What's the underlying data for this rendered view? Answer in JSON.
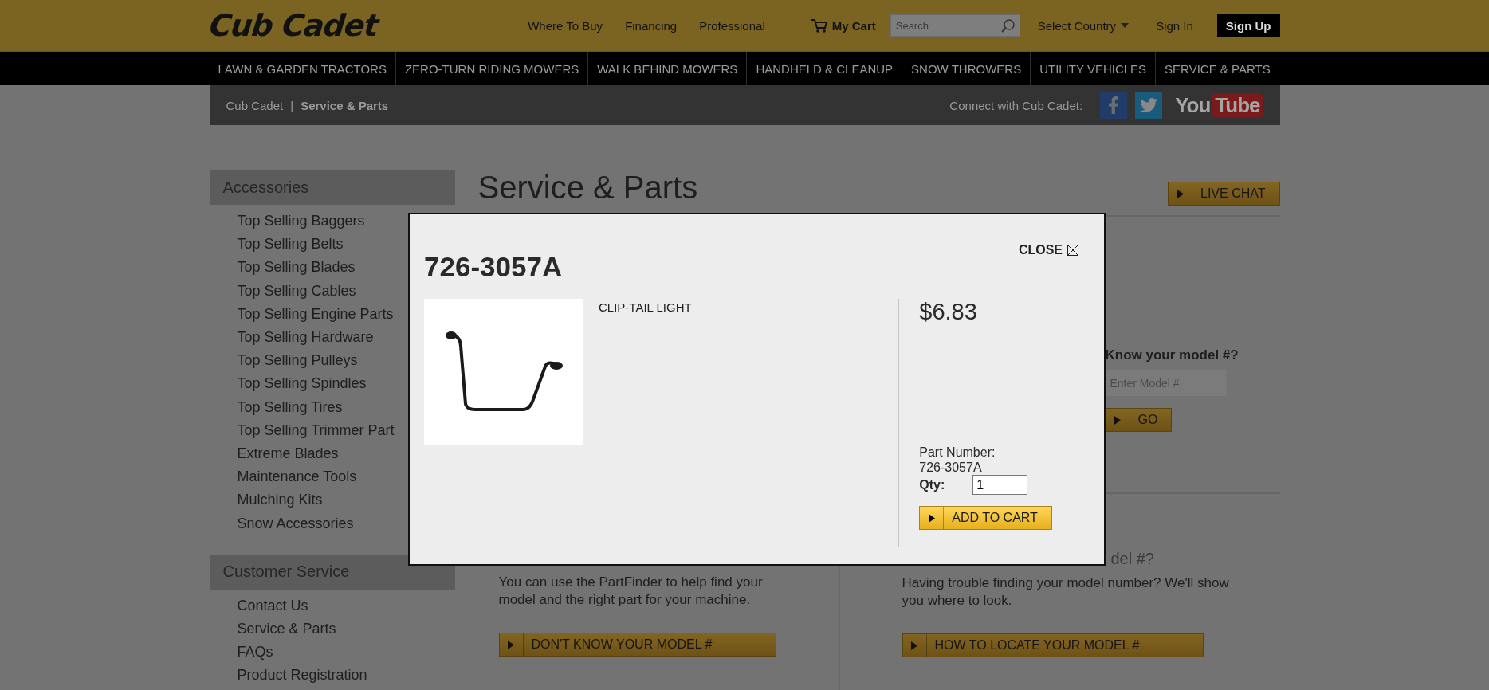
{
  "header": {
    "logo": "Cub Cadet",
    "links": [
      "Where To Buy",
      "Financing",
      "Professional"
    ],
    "cart": "My Cart",
    "search": {
      "placeholder": "Search"
    },
    "country": "Select Country",
    "sign_in": "Sign In",
    "sign_up": "Sign Up"
  },
  "nav": [
    "LAWN & GARDEN TRACTORS",
    "ZERO-TURN RIDING MOWERS",
    "WALK BEHIND MOWERS",
    "HANDHELD & CLEANUP",
    "SNOW THROWERS",
    "UTILITY VEHICLES",
    "SERVICE & PARTS"
  ],
  "breadcrumb": {
    "items": [
      {
        "label": "Cub Cadet",
        "current": false
      },
      {
        "label": "Service & Parts",
        "current": true
      }
    ],
    "separator": "|"
  },
  "social": {
    "label": "Connect with Cub Cadet:",
    "items": [
      {
        "kind": "facebook"
      },
      {
        "kind": "twitter"
      },
      {
        "kind": "youtube",
        "text": "You",
        "badge": "Tube"
      }
    ]
  },
  "sidebar": [
    {
      "title": "Accessories",
      "items": [
        "Top Selling Baggers",
        "Top Selling Belts",
        "Top Selling Blades",
        "Top Selling Cables",
        "Top Selling Engine Parts",
        "Top Selling Hardware",
        "Top Selling Pulleys",
        "Top Selling Spindles",
        "Top Selling Tires",
        "Top Selling Trimmer Part",
        "Extreme Blades",
        "Maintenance Tools",
        "Mulching Kits",
        "Snow Accessories"
      ]
    },
    {
      "title": "Customer Service",
      "items": [
        "Contact Us",
        "Service & Parts",
        "FAQs",
        "Product Registration"
      ]
    }
  ],
  "main": {
    "title": "Service & Parts",
    "live_chat": "LIVE CHAT",
    "finder": {
      "heading": "Know your model #?",
      "input": {
        "placeholder": "Enter Model #"
      },
      "button": "GO"
    },
    "columns": [
      {
        "paragraph": "You can use the PartFinder to help find your model and the right part for your machine.",
        "button": "DON'T KNOW YOUR MODEL #"
      },
      {
        "heading": "del #?",
        "paragraph": "Having trouble finding your model number? We'll show you where to look.",
        "button": "HOW TO LOCATE YOUR MODEL #"
      }
    ]
  },
  "modal": {
    "title": "726-3057A",
    "close": "CLOSE",
    "description": "CLIP-TAIL LIGHT",
    "price": "$6.83",
    "part_number_label": "Part Number:",
    "part_number": "726-3057A",
    "qty_label": "Qty:",
    "qty": "1",
    "add_to_cart": "ADD TO CART"
  }
}
